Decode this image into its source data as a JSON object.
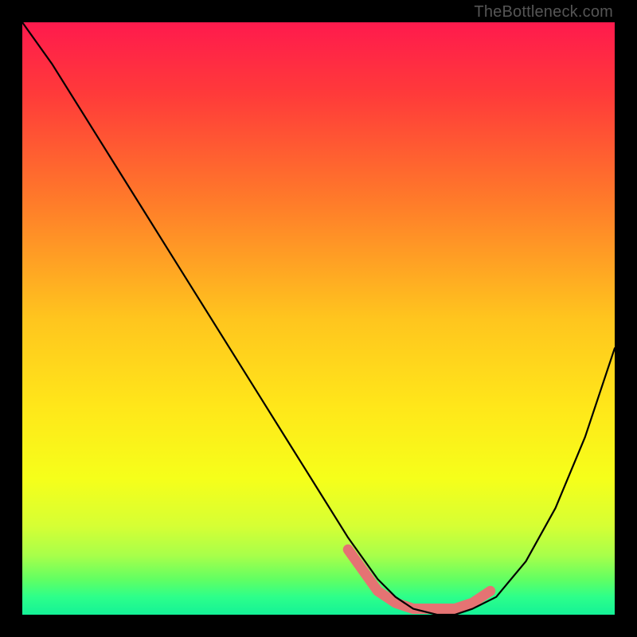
{
  "watermark": "TheBottleneck.com",
  "chart_data": {
    "type": "line",
    "title": "",
    "xlabel": "",
    "ylabel": "",
    "xlim": [
      0,
      100
    ],
    "ylim": [
      0,
      100
    ],
    "series": [
      {
        "name": "bottleneck-curve",
        "x": [
          0,
          5,
          10,
          15,
          20,
          25,
          30,
          35,
          40,
          45,
          50,
          55,
          60,
          63,
          66,
          70,
          73,
          76,
          80,
          85,
          90,
          95,
          100
        ],
        "values": [
          100,
          93,
          85,
          77,
          69,
          61,
          53,
          45,
          37,
          29,
          21,
          13,
          6,
          3,
          1,
          0,
          0,
          1,
          3,
          9,
          18,
          30,
          45
        ]
      },
      {
        "name": "highlight-band",
        "x": [
          55,
          60,
          63,
          66,
          70,
          73,
          76,
          79
        ],
        "values": [
          11,
          4,
          2,
          1,
          1,
          1,
          2,
          4
        ]
      }
    ],
    "gradient_stops": [
      {
        "offset": 0.0,
        "color": "#ff1a4d"
      },
      {
        "offset": 0.12,
        "color": "#ff3a3a"
      },
      {
        "offset": 0.3,
        "color": "#ff7a2a"
      },
      {
        "offset": 0.5,
        "color": "#ffc51e"
      },
      {
        "offset": 0.65,
        "color": "#ffe71a"
      },
      {
        "offset": 0.77,
        "color": "#f6ff1a"
      },
      {
        "offset": 0.85,
        "color": "#d6ff34"
      },
      {
        "offset": 0.9,
        "color": "#a8ff4a"
      },
      {
        "offset": 0.94,
        "color": "#62ff62"
      },
      {
        "offset": 0.97,
        "color": "#2dff8a"
      },
      {
        "offset": 1.0,
        "color": "#14f297"
      }
    ],
    "colors": {
      "curve": "#000000",
      "highlight": "#e57373",
      "frame": "#000000"
    }
  }
}
